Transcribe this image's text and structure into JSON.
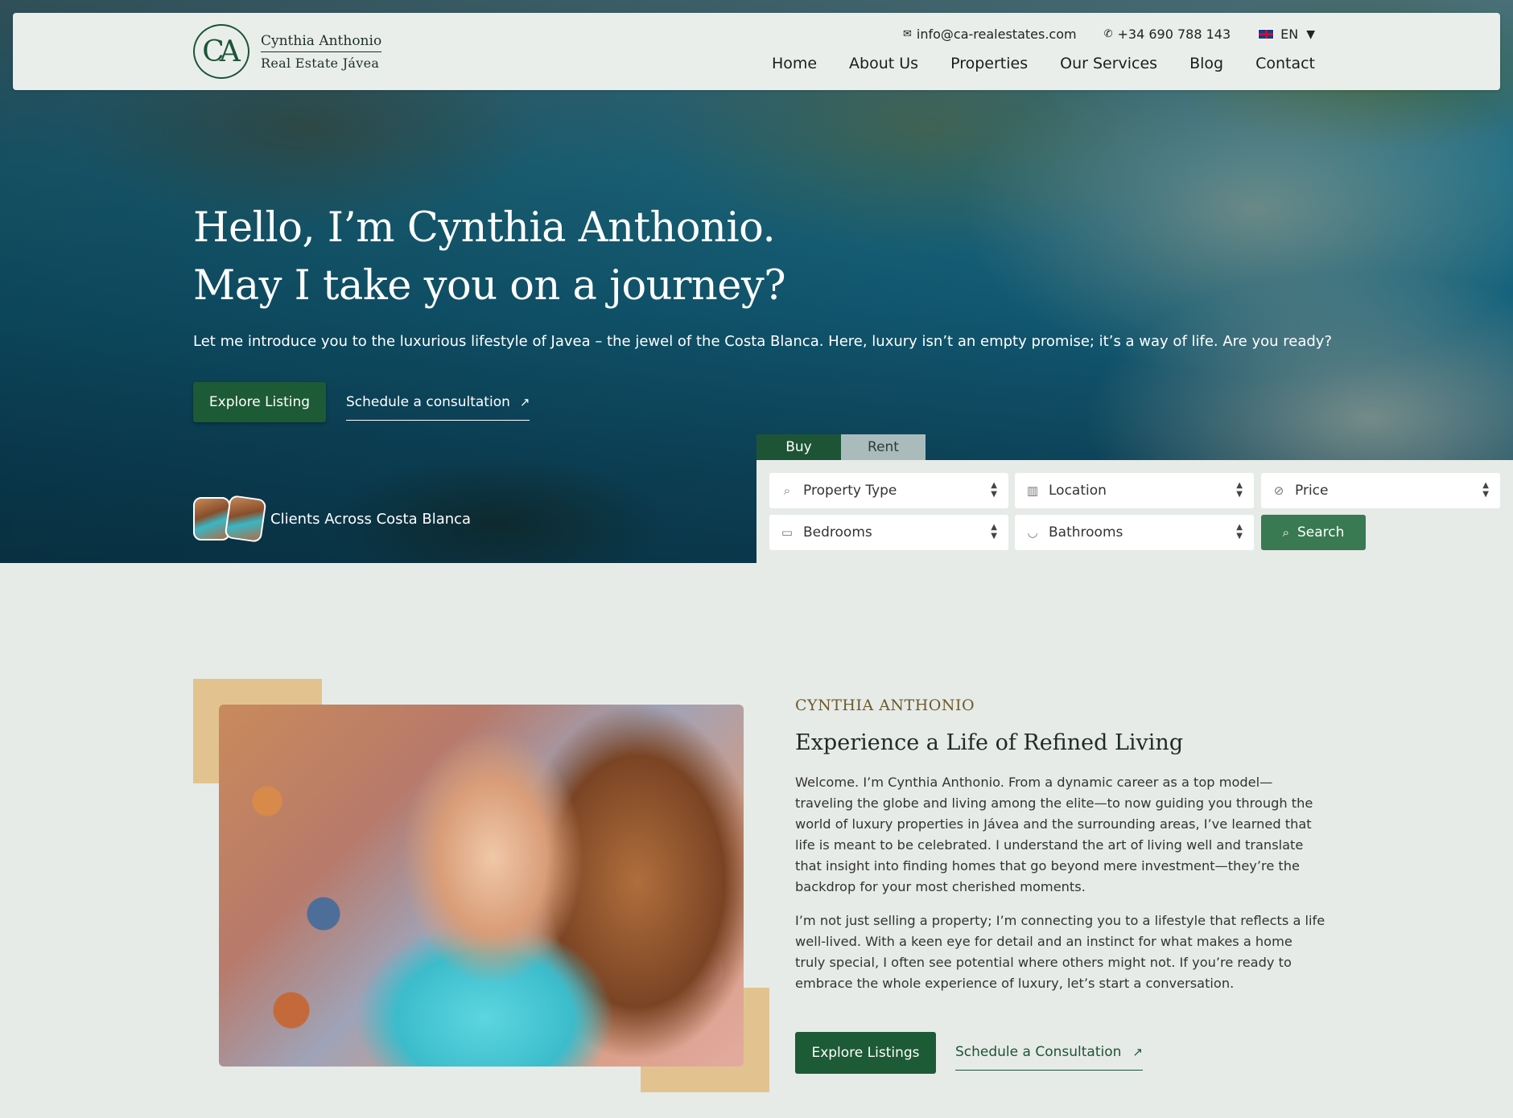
{
  "header": {
    "logo_mark": "CA",
    "logo_line1": "Cynthia Anthonio",
    "logo_line2": "Real Estate Jávea",
    "email": "info@ca-realestates.com",
    "phone": "+34 690 788 143",
    "language": "EN",
    "nav": [
      "Home",
      "About Us",
      "Properties",
      "Our Services",
      "Blog",
      "Contact"
    ]
  },
  "hero": {
    "title_line1": "Hello, I’m Cynthia Anthonio.",
    "title_line2": "May I take you on a journey?",
    "subtitle": "Let me introduce you to the luxurious lifestyle of Javea – the jewel of the Costa Blanca. Here, luxury isn’t an empty promise; it’s a way of life. Are you ready?",
    "primary_button": "Explore Listing",
    "secondary_link": "Schedule a consultation",
    "clients_label": "Clients Across Costa Blanca"
  },
  "search": {
    "tabs": [
      "Buy",
      "Rent"
    ],
    "active_tab": "Buy",
    "fields": {
      "property_type": "Property Type",
      "location": "Location",
      "price": "Price",
      "bedrooms": "Bedrooms",
      "bathrooms": "Bathrooms"
    },
    "button": "Search"
  },
  "about": {
    "eyebrow": "CYNTHIA ANTHONIO",
    "title": "Experience a Life of Refined Living",
    "paragraph1": "Welcome. I’m Cynthia Anthonio. From a dynamic career as a top model—traveling the globe and living among the elite—to now guiding you through the world of luxury properties in Jávea and the surrounding areas, I’ve learned that life is meant to be celebrated. I understand the art of living well and translate that insight into finding homes that go beyond mere investment—they’re the backdrop for your most cherished moments.",
    "paragraph2": "I’m not just selling a property; I’m connecting you to a lifestyle that reflects a life well-lived. With a keen eye for detail and an instinct for what makes a home truly special, I often see potential where others might not. If you’re ready to embrace the whole experience of luxury, let’s start a conversation.",
    "primary_button": "Explore Listings",
    "secondary_link": "Schedule a Consultation"
  },
  "colors": {
    "brand_green": "#1d5436",
    "button_green": "#1d5a36",
    "search_green": "#397a52",
    "accent_gold": "#e2c38f",
    "eyebrow": "#6e5a2a",
    "page_bg": "#e6ebe8"
  }
}
